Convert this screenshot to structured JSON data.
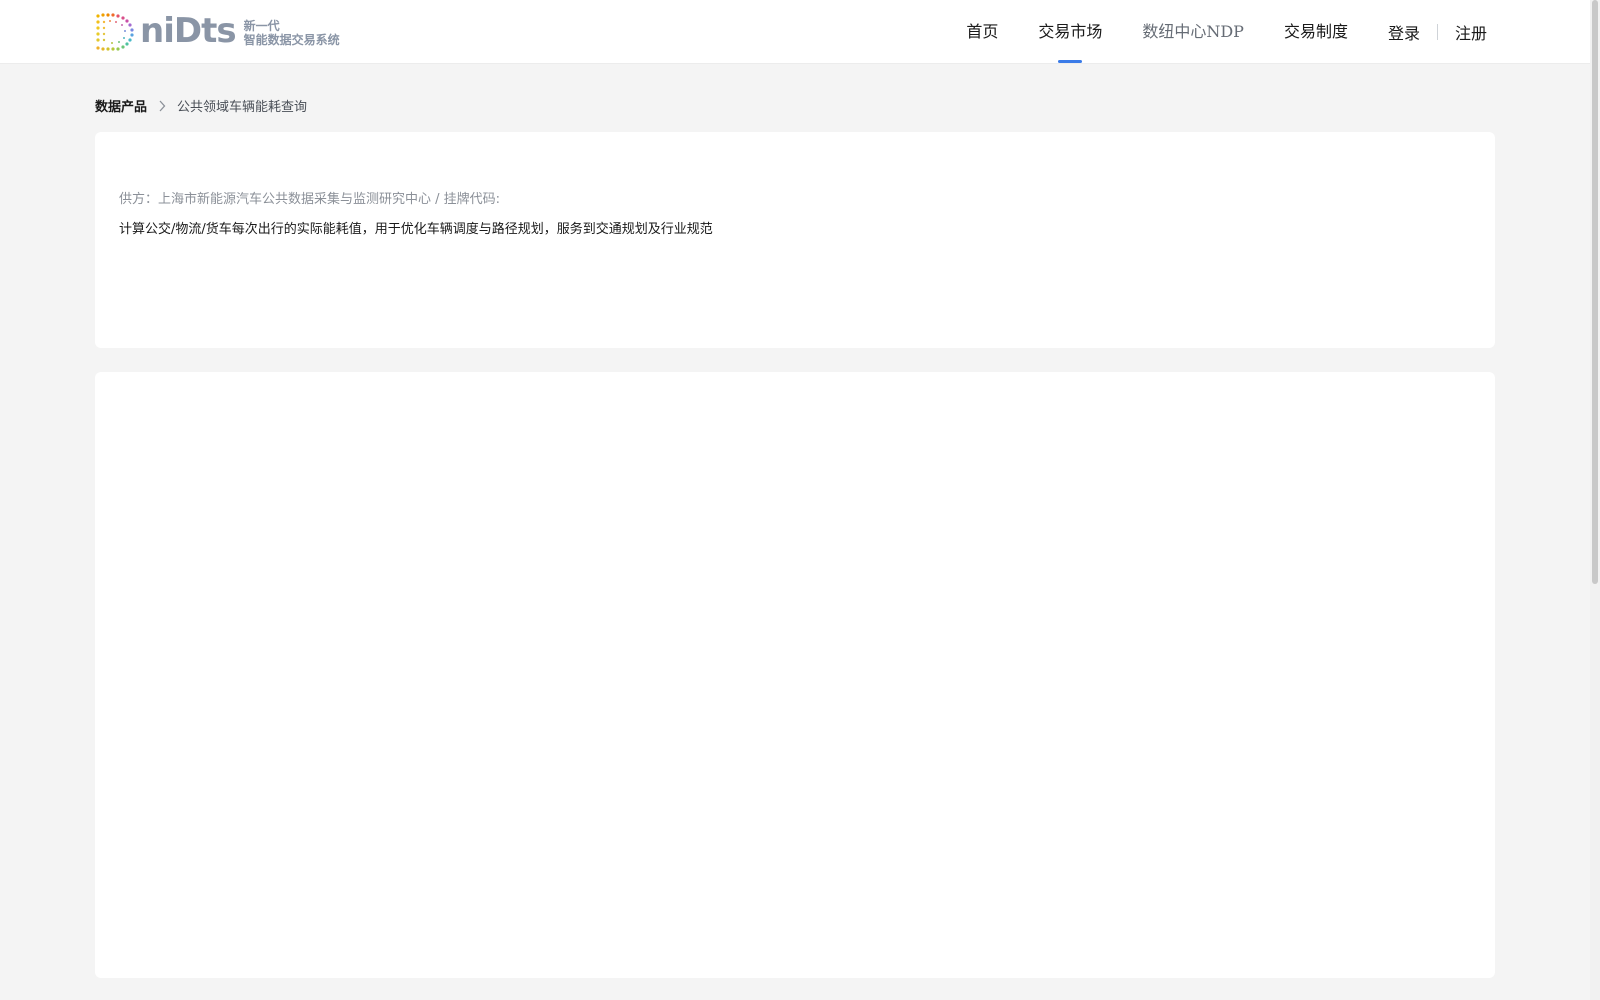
{
  "header": {
    "logo_word": "niDts",
    "logo_tagline_line1": "新一代",
    "logo_tagline_line2": "智能数据交易系统",
    "nav": [
      {
        "label": "首页"
      },
      {
        "label": "交易市场",
        "active": true
      },
      {
        "label": "数纽中心NDP"
      },
      {
        "label": "交易制度"
      }
    ],
    "login_label": "登录",
    "register_label": "注册"
  },
  "breadcrumb": {
    "root": "数据产品",
    "separator_icon": "chevron-right-icon",
    "current": "公共领域车辆能耗查询"
  },
  "product": {
    "supplier_line": "供方：上海市新能源汽车公共数据采集与监测研究中心 / 挂牌代码:",
    "description": "计算公交/物流/货车每次出行的实际能耗值，用于优化车辆调度与路径规划，服务到交通规划及行业规范"
  },
  "colors": {
    "accent": "#3a7be8",
    "page_bg": "#f4f4f4",
    "card_bg": "#ffffff",
    "muted_text": "#8b9098"
  }
}
